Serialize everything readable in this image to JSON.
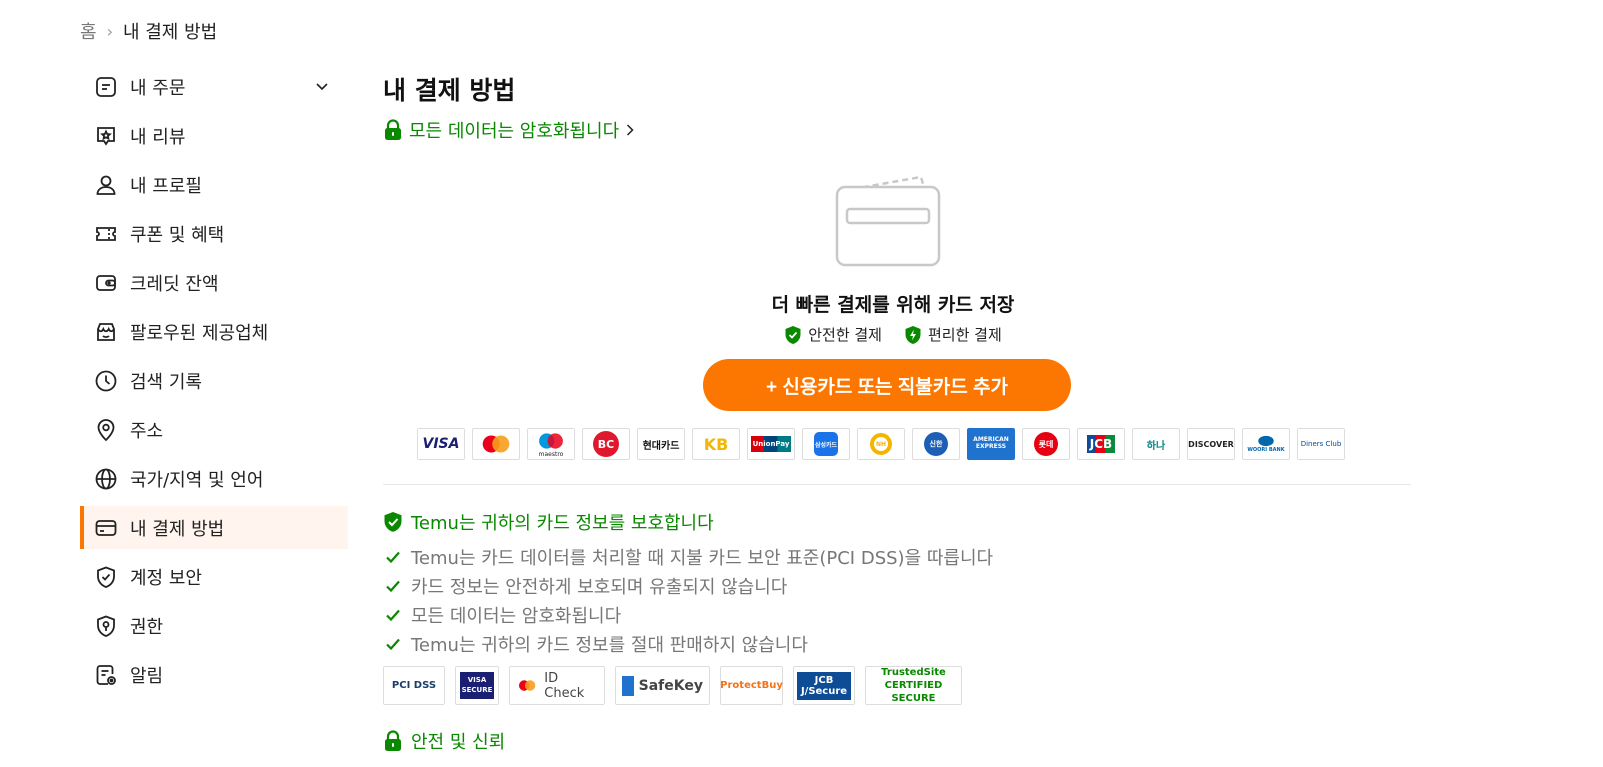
{
  "breadcrumb": {
    "home": "홈",
    "separator": "›",
    "current": "내 결제 방법"
  },
  "sidebar": {
    "items": [
      {
        "label": "내 주문",
        "icon": "order-icon"
      },
      {
        "label": "내 리뷰",
        "icon": "review-icon"
      },
      {
        "label": "내 프로필",
        "icon": "profile-icon"
      },
      {
        "label": "쿠폰 및 혜택",
        "icon": "coupon-icon"
      },
      {
        "label": "크레딧 잔액",
        "icon": "wallet-icon"
      },
      {
        "label": "팔로우된 제공업체",
        "icon": "store-icon"
      },
      {
        "label": "검색 기록",
        "icon": "clock-icon"
      },
      {
        "label": "주소",
        "icon": "location-icon"
      },
      {
        "label": "국가/지역 및 언어",
        "icon": "globe-icon"
      },
      {
        "label": "내 결제 방법",
        "icon": "card-icon"
      },
      {
        "label": "계정 보안",
        "icon": "shield-check-icon"
      },
      {
        "label": "권한",
        "icon": "permission-icon"
      },
      {
        "label": "알림",
        "icon": "notification-icon"
      }
    ]
  },
  "main": {
    "title": "내 결제 방법",
    "encrypt_link": "모든 데이터는 암호화됩니다",
    "save_title": "더 빠른 결제를 위해 카드 저장",
    "benefit_secure": "안전한 결제",
    "benefit_convenient": "편리한 결제",
    "add_button": "+ 신용카드 또는 직불카드 추가",
    "card_logos": [
      "VISA",
      "Mastercard",
      "maestro",
      "BC",
      "현대카드",
      "KB",
      "UnionPay",
      "삼성카드",
      "NH",
      "신한",
      "AMERICAN EXPRESS",
      "롯데",
      "JCB",
      "하나",
      "DISCOVER",
      "WOORI BANK",
      "Diners Club"
    ],
    "protect_title": "Temu는 귀하의 카드 정보를 보호합니다",
    "protect_items": [
      "Temu는 카드 데이터를 처리할 때 지불 카드 보안 표준(PCI DSS)을 따릅니다",
      "카드 정보는 안전하게 보호되며 유출되지 않습니다",
      "모든 데이터는 암호화됩니다",
      "Temu는 귀하의 카드 정보를 절대 판매하지 않습니다"
    ],
    "security_logos": [
      "PCI DSS",
      "VISA SECURE",
      "ID Check",
      "SafeKey",
      "ProtectBuy",
      "JCB J/Secure",
      "TrustedSite CERTIFIED SECURE"
    ],
    "safe_title": "안전 및 신뢰"
  },
  "colors": {
    "accent": "#fb7701",
    "green": "#0a8800"
  }
}
